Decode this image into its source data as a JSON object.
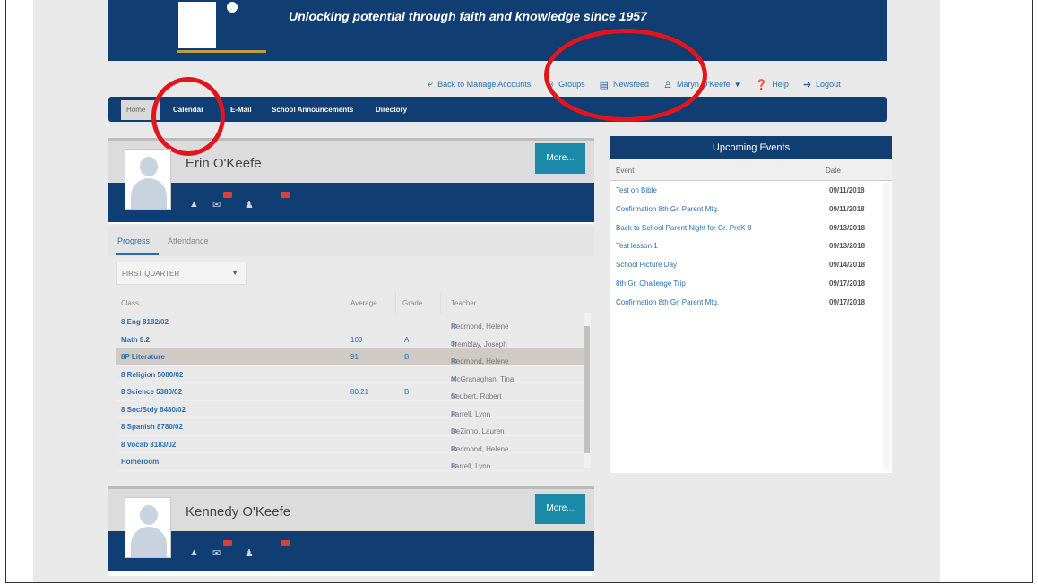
{
  "banner": {
    "tagline": "Unlocking potential through faith and knowledge since 1957"
  },
  "utility": {
    "back": "Back to Manage Accounts",
    "groups": "Groups",
    "newsfeed": "Newsfeed",
    "user": "Maryn O'Keefe",
    "help": "Help",
    "logout": "Logout"
  },
  "nav": {
    "home": "Home",
    "calendar": "Calendar",
    "email": "E-Mail",
    "announcements": "School Announcements",
    "directory": "Directory"
  },
  "student1": {
    "name": "Erin O'Keefe",
    "more": "More..."
  },
  "student2": {
    "name": "Kennedy O'Keefe",
    "more": "More..."
  },
  "tabs": {
    "progress": "Progress",
    "attendance": "Attendance"
  },
  "quarter": {
    "selected": "FIRST QUARTER"
  },
  "class_table": {
    "headers": {
      "class": "Class",
      "average": "Average",
      "grade": "Grade",
      "teacher": "Teacher"
    },
    "rows": [
      {
        "class": "8 Eng 8182/02",
        "average": "",
        "grade": "",
        "teacher": "Redmond, Helene"
      },
      {
        "class": "Math 8.2",
        "average": "100",
        "grade": "A",
        "teacher": "Tremblay, Joseph"
      },
      {
        "class": "8P Literature",
        "average": "91",
        "grade": "B",
        "teacher": "Redmond, Helene"
      },
      {
        "class": "8 Religion 5080/02",
        "average": "",
        "grade": "",
        "teacher": "McGranaghan, Tina"
      },
      {
        "class": "8 Science 5380/02",
        "average": "80.21",
        "grade": "B",
        "teacher": "Seubert, Robert"
      },
      {
        "class": "8 Soc/Stdy 8480/02",
        "average": "",
        "grade": "",
        "teacher": "Farrell, Lynn"
      },
      {
        "class": "8 Spanish 8780/02",
        "average": "",
        "grade": "",
        "teacher": "DeZinno, Lauren"
      },
      {
        "class": "8 Vocab 3183/02",
        "average": "",
        "grade": "",
        "teacher": "Redmond, Helene"
      },
      {
        "class": "Homeroom",
        "average": "",
        "grade": "",
        "teacher": "Farrell, Lynn"
      }
    ]
  },
  "events": {
    "title": "Upcoming Events",
    "col_event": "Event",
    "col_date": "Date",
    "rows": [
      {
        "event": "Test on Bible",
        "date": "09/11/2018"
      },
      {
        "event": "Confirmation 8th Gr. Parent Mtg.",
        "date": "09/11/2018"
      },
      {
        "event": "Back to School Parent Night for Gr. PreK-8",
        "date": "09/13/2018"
      },
      {
        "event": "Test lesson 1",
        "date": "09/13/2018"
      },
      {
        "event": "School Picture Day",
        "date": "09/14/2018"
      },
      {
        "event": "8th Gr. Challenge Trip",
        "date": "09/17/2018"
      },
      {
        "event": "Confirmation 8th Gr. Parent Mtg.",
        "date": "09/17/2018"
      }
    ]
  },
  "colors": {
    "navy": "#103e72",
    "link": "#2a6fb0",
    "button": "#1a8aa8",
    "annotation": "#e2141c"
  }
}
